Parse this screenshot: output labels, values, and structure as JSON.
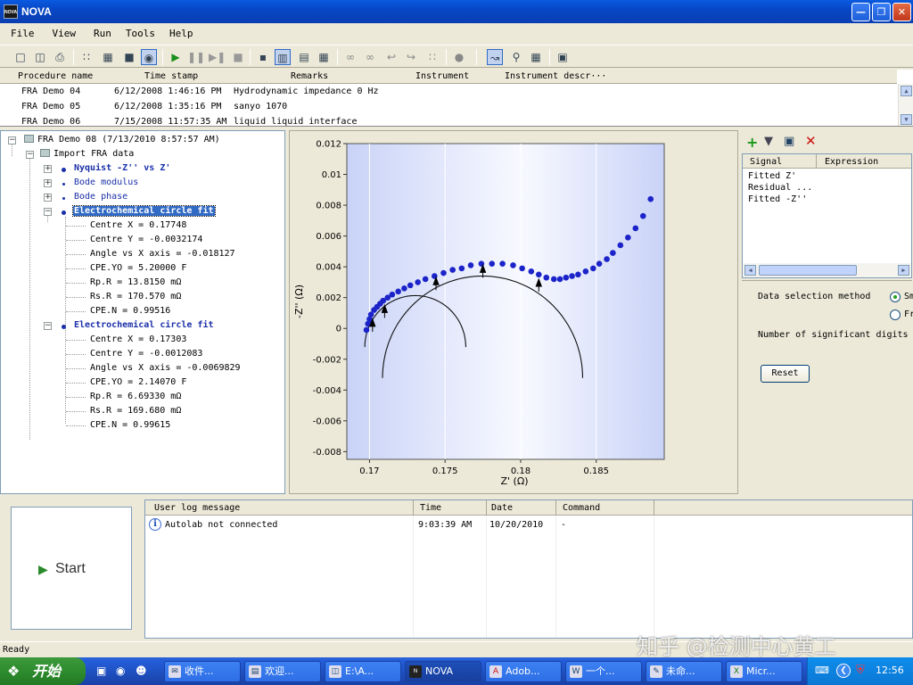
{
  "window": {
    "title": "NOVA",
    "app_icon": "nova-app-icon"
  },
  "menu": [
    "File",
    "View",
    "Run",
    "Tools",
    "Help"
  ],
  "procedures": {
    "columns": [
      "Procedure name",
      "Time stamp",
      "Remarks",
      "Instrument",
      "Instrument descr···"
    ],
    "rows": [
      [
        "FRA Demo 04",
        "6/12/2008 1:46:16 PM",
        "Hydrodynamic impedance 0 Hz"
      ],
      [
        "FRA Demo 05",
        "6/12/2008 1:35:16 PM",
        "sanyo 1070"
      ],
      [
        "FRA Demo 06",
        "7/15/2008 11:57:35 AM",
        "liquid liquid interface"
      ]
    ]
  },
  "tree": {
    "root": "FRA Demo 08  (7/13/2010 8:57:57 AM)",
    "import": "Import FRA data",
    "items": [
      "Nyquist -Z'' vs Z'",
      "Bode modulus",
      "Bode phase"
    ],
    "fit1": {
      "label": "Electrochemical circle fit",
      "params": [
        "Centre X = 0.17748",
        "Centre Y = -0.0032174",
        "Angle vs X axis = -0.018127",
        "CPE.YO = 5.20000 F",
        "Rp.R = 13.8150 mΩ",
        "Rs.R = 170.570 mΩ",
        "CPE.N = 0.99516"
      ]
    },
    "fit2": {
      "label": "Electrochemical circle fit",
      "params": [
        "Centre X = 0.17303",
        "Centre Y = -0.0012083",
        "Angle vs X axis = -0.0069829",
        "CPE.YO = 2.14070 F",
        "Rp.R = 6.69330 mΩ",
        "Rs.R = 169.680 mΩ",
        "CPE.N = 0.99615"
      ]
    }
  },
  "chart_data": {
    "type": "scatter",
    "xlabel": "Z' (Ω)",
    "ylabel": "-Z'' (Ω)",
    "xlim": [
      0.1685,
      0.1895
    ],
    "ylim": [
      -0.0085,
      0.012
    ],
    "x_ticks": [
      "0.17",
      "0.175",
      "0.18",
      "0.185"
    ],
    "x_tick_values": [
      0.17,
      0.175,
      0.18,
      0.185
    ],
    "y_ticks": [
      "0.012",
      "0.01",
      "0.008",
      "0.006",
      "0.004",
      "0.002",
      "0",
      "-0.002",
      "-0.004",
      "-0.006",
      "-0.008"
    ],
    "y_tick_values": [
      0.012,
      0.01,
      0.008,
      0.006,
      0.004,
      0.002,
      0,
      -0.002,
      -0.004,
      -0.006,
      -0.008
    ],
    "points": [
      [
        0.1698,
        -0.0001
      ],
      [
        0.1699,
        0.0003
      ],
      [
        0.17,
        0.0006
      ],
      [
        0.1701,
        0.0009
      ],
      [
        0.1703,
        0.0012
      ],
      [
        0.1705,
        0.0014
      ],
      [
        0.1707,
        0.0016
      ],
      [
        0.1709,
        0.0018
      ],
      [
        0.1712,
        0.002
      ],
      [
        0.1715,
        0.0022
      ],
      [
        0.1719,
        0.0024
      ],
      [
        0.1723,
        0.0026
      ],
      [
        0.1727,
        0.0028
      ],
      [
        0.1732,
        0.003
      ],
      [
        0.1737,
        0.0032
      ],
      [
        0.1743,
        0.0034
      ],
      [
        0.1749,
        0.0036
      ],
      [
        0.1755,
        0.0038
      ],
      [
        0.1761,
        0.0039
      ],
      [
        0.1767,
        0.0041
      ],
      [
        0.1774,
        0.0042
      ],
      [
        0.1781,
        0.0042
      ],
      [
        0.1788,
        0.0042
      ],
      [
        0.1795,
        0.0041
      ],
      [
        0.1801,
        0.0039
      ],
      [
        0.1807,
        0.0037
      ],
      [
        0.1812,
        0.0035
      ],
      [
        0.1817,
        0.0033
      ],
      [
        0.1822,
        0.0032
      ],
      [
        0.1826,
        0.0032
      ],
      [
        0.183,
        0.0033
      ],
      [
        0.1834,
        0.0034
      ],
      [
        0.1838,
        0.0035
      ],
      [
        0.1843,
        0.0037
      ],
      [
        0.1848,
        0.0039
      ],
      [
        0.1852,
        0.0042
      ],
      [
        0.1857,
        0.0045
      ],
      [
        0.1861,
        0.0049
      ],
      [
        0.1866,
        0.0054
      ],
      [
        0.1871,
        0.0059
      ],
      [
        0.1876,
        0.0065
      ],
      [
        0.1881,
        0.0073
      ],
      [
        0.1886,
        0.0084
      ]
    ],
    "fit_circles": [
      {
        "centre_x": 0.17748,
        "centre_y": -0.0032174,
        "x_from": 0.17086,
        "x_to": 0.1851
      },
      {
        "centre_x": 0.17303,
        "centre_y": -0.0012083,
        "x_from": 0.16969,
        "x_to": 0.17639
      }
    ],
    "markers": [
      [
        0.1702,
        0.0006
      ],
      [
        0.171,
        0.0015
      ],
      [
        0.1744,
        0.0033
      ],
      [
        0.1775,
        0.0041
      ],
      [
        0.1812,
        0.0032
      ]
    ],
    "grid": true
  },
  "signals": {
    "columns": [
      "Signal",
      "Expression"
    ],
    "rows": [
      "Fitted Z'",
      "Residual ...",
      "Fitted -Z''"
    ]
  },
  "options": {
    "method_label": "Data selection method",
    "radio1": "Sm",
    "radio2": "Fr",
    "digits_label": "Number of significant digits",
    "reset": "Reset"
  },
  "start": {
    "label": "Start"
  },
  "log": {
    "columns": [
      "User log message",
      "Time",
      "Date",
      "Command"
    ],
    "rows": [
      [
        "Autolab not connected",
        "9:03:39 AM",
        "10/20/2010",
        "-"
      ]
    ]
  },
  "status": "Ready",
  "taskbar": {
    "start": "开始",
    "tasks": [
      "收件...",
      "欢迎...",
      "E:\\A...",
      "NOVA",
      "Adob...",
      "一个...",
      "未命...",
      "Micr..."
    ],
    "clock": "12:56"
  },
  "watermark": "知乎 @检测中心黄工"
}
